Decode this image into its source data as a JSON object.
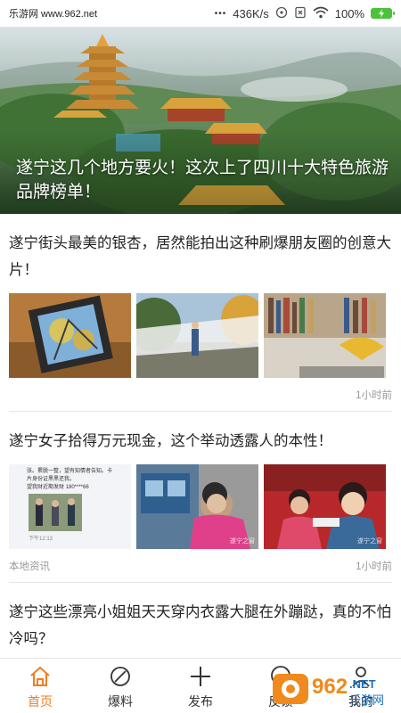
{
  "status_bar": {
    "watermark": "乐游网 www.962.net",
    "dots": "•••",
    "speed": "436K/s",
    "battery_percent": "100%",
    "battery_color": "#4cc13b"
  },
  "hero": {
    "caption": "遂宁这几个地方要火！这次上了四川十大特色旅游品牌榜单！"
  },
  "articles": [
    {
      "title": "遂宁街头最美的银杏，居然能拍出这种刷爆朋友圈的创意大片！",
      "source": "",
      "time": "1小时前"
    },
    {
      "title": "遂宁女子拾得万元现金，这个举动透露人的本性！",
      "source": "本地资讯",
      "time": "1小时前",
      "thumb1_lines": [
        "张。累脱一整，望有知情者告知。卡",
        "片身份证黑黑还我。",
        "望我财近期发财 180****66"
      ],
      "thumb1_footer": "下午12:13",
      "thumb_watermark": "遂宁之窗"
    },
    {
      "title": "遂宁这些漂亮小姐姐天天穿内衣露大腿在外蹦跶，真的不怕冷吗？",
      "source": "",
      "time": ""
    }
  ],
  "tabbar": {
    "accent_color": "#f27c1f",
    "tabs": [
      {
        "label": "首页",
        "icon": "home-icon",
        "active": true
      },
      {
        "label": "爆料",
        "icon": "compass-icon",
        "active": false
      },
      {
        "label": "发布",
        "icon": "plus-icon",
        "active": false
      },
      {
        "label": "反馈",
        "icon": "chat-icon",
        "active": false
      },
      {
        "label": "我的",
        "icon": "user-icon",
        "active": false
      }
    ]
  },
  "watermark_logo": {
    "brand": "962",
    "sub": "乐游网",
    "net": ".NET"
  }
}
